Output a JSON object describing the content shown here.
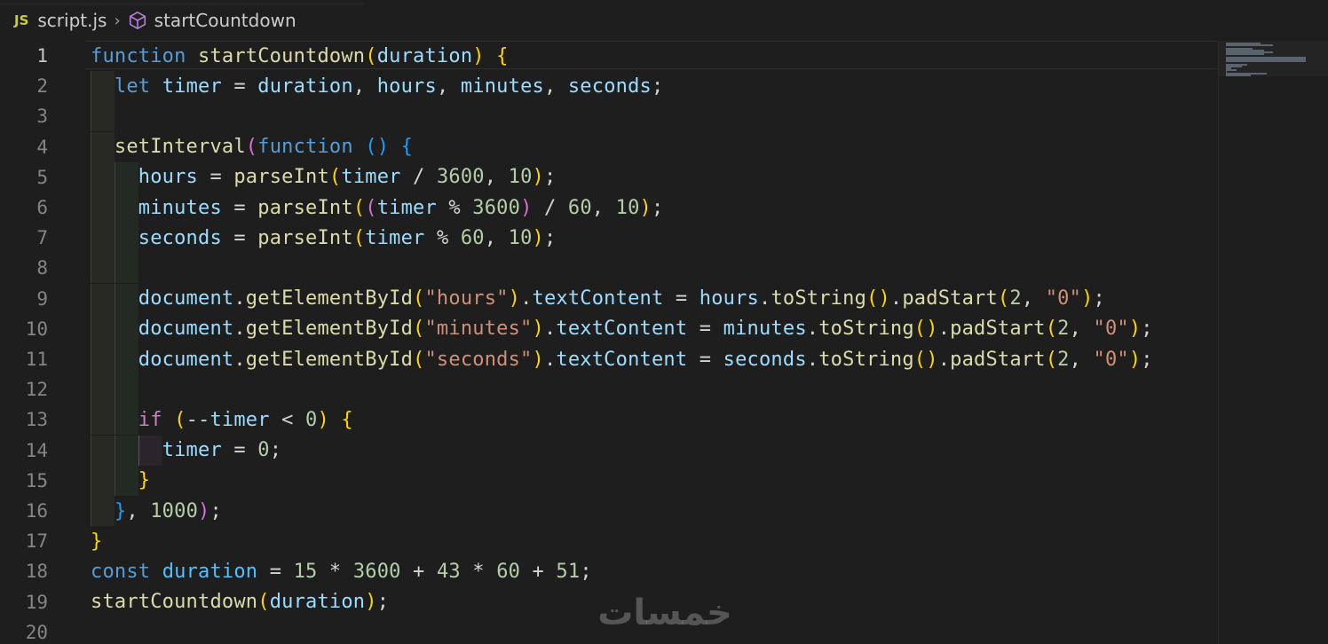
{
  "breadcrumb": {
    "file_icon": "JS",
    "file_name": "script.js",
    "separator": "›",
    "symbol_icon": "cube-icon",
    "symbol_name": "startCountdown"
  },
  "editor": {
    "active_line": 1,
    "line_numbers": [
      "1",
      "2",
      "3",
      "4",
      "5",
      "6",
      "7",
      "8",
      "9",
      "10",
      "11",
      "12",
      "13",
      "14",
      "15",
      "16",
      "17",
      "18",
      "19",
      "20"
    ],
    "lines": [
      [
        [
          "kw",
          "function"
        ],
        [
          "",
          " "
        ],
        [
          "fn",
          "startCountdown"
        ],
        [
          "b1",
          "("
        ],
        [
          "var",
          "duration"
        ],
        [
          "b1",
          ")"
        ],
        [
          "",
          " "
        ],
        [
          "b1",
          "{"
        ]
      ],
      [
        [
          "",
          "  "
        ],
        [
          "kw",
          "let"
        ],
        [
          "",
          " "
        ],
        [
          "var",
          "timer"
        ],
        [
          "",
          " = "
        ],
        [
          "var",
          "duration"
        ],
        [
          "",
          ", "
        ],
        [
          "var",
          "hours"
        ],
        [
          "",
          ", "
        ],
        [
          "var",
          "minutes"
        ],
        [
          "",
          ", "
        ],
        [
          "var",
          "seconds"
        ],
        [
          "",
          ";"
        ]
      ],
      [],
      [
        [
          "",
          "  "
        ],
        [
          "fn",
          "setInterval"
        ],
        [
          "b2",
          "("
        ],
        [
          "kw",
          "function"
        ],
        [
          "",
          " "
        ],
        [
          "b3",
          "()"
        ],
        [
          "",
          " "
        ],
        [
          "b3",
          "{"
        ]
      ],
      [
        [
          "",
          "    "
        ],
        [
          "var",
          "hours"
        ],
        [
          "",
          " = "
        ],
        [
          "fn",
          "parseInt"
        ],
        [
          "b1",
          "("
        ],
        [
          "var",
          "timer"
        ],
        [
          "",
          " / "
        ],
        [
          "num",
          "3600"
        ],
        [
          "",
          ", "
        ],
        [
          "num",
          "10"
        ],
        [
          "b1",
          ")"
        ],
        [
          "",
          ";"
        ]
      ],
      [
        [
          "",
          "    "
        ],
        [
          "var",
          "minutes"
        ],
        [
          "",
          " = "
        ],
        [
          "fn",
          "parseInt"
        ],
        [
          "b1",
          "("
        ],
        [
          "b2",
          "("
        ],
        [
          "var",
          "timer"
        ],
        [
          "",
          " % "
        ],
        [
          "num",
          "3600"
        ],
        [
          "b2",
          ")"
        ],
        [
          "",
          " / "
        ],
        [
          "num",
          "60"
        ],
        [
          "",
          ", "
        ],
        [
          "num",
          "10"
        ],
        [
          "b1",
          ")"
        ],
        [
          "",
          ";"
        ]
      ],
      [
        [
          "",
          "    "
        ],
        [
          "var",
          "seconds"
        ],
        [
          "",
          " = "
        ],
        [
          "fn",
          "parseInt"
        ],
        [
          "b1",
          "("
        ],
        [
          "var",
          "timer"
        ],
        [
          "",
          " % "
        ],
        [
          "num",
          "60"
        ],
        [
          "",
          ", "
        ],
        [
          "num",
          "10"
        ],
        [
          "b1",
          ")"
        ],
        [
          "",
          ";"
        ]
      ],
      [],
      [
        [
          "",
          "    "
        ],
        [
          "var",
          "document"
        ],
        [
          "",
          "."
        ],
        [
          "fn",
          "getElementById"
        ],
        [
          "b1",
          "("
        ],
        [
          "str",
          "\"hours\""
        ],
        [
          "b1",
          ")"
        ],
        [
          "",
          "."
        ],
        [
          "var",
          "textContent"
        ],
        [
          "",
          " = "
        ],
        [
          "var",
          "hours"
        ],
        [
          "",
          "."
        ],
        [
          "fn",
          "toString"
        ],
        [
          "b1",
          "()"
        ],
        [
          "",
          "."
        ],
        [
          "fn",
          "padStart"
        ],
        [
          "b1",
          "("
        ],
        [
          "num",
          "2"
        ],
        [
          "",
          ", "
        ],
        [
          "str",
          "\"0\""
        ],
        [
          "b1",
          ")"
        ],
        [
          "",
          ";"
        ]
      ],
      [
        [
          "",
          "    "
        ],
        [
          "var",
          "document"
        ],
        [
          "",
          "."
        ],
        [
          "fn",
          "getElementById"
        ],
        [
          "b1",
          "("
        ],
        [
          "str",
          "\"minutes\""
        ],
        [
          "b1",
          ")"
        ],
        [
          "",
          "."
        ],
        [
          "var",
          "textContent"
        ],
        [
          "",
          " = "
        ],
        [
          "var",
          "minutes"
        ],
        [
          "",
          "."
        ],
        [
          "fn",
          "toString"
        ],
        [
          "b1",
          "()"
        ],
        [
          "",
          "."
        ],
        [
          "fn",
          "padStart"
        ],
        [
          "b1",
          "("
        ],
        [
          "num",
          "2"
        ],
        [
          "",
          ", "
        ],
        [
          "str",
          "\"0\""
        ],
        [
          "b1",
          ")"
        ],
        [
          "",
          ";"
        ]
      ],
      [
        [
          "",
          "    "
        ],
        [
          "var",
          "document"
        ],
        [
          "",
          "."
        ],
        [
          "fn",
          "getElementById"
        ],
        [
          "b1",
          "("
        ],
        [
          "str",
          "\"seconds\""
        ],
        [
          "b1",
          ")"
        ],
        [
          "",
          "."
        ],
        [
          "var",
          "textContent"
        ],
        [
          "",
          " = "
        ],
        [
          "var",
          "seconds"
        ],
        [
          "",
          "."
        ],
        [
          "fn",
          "toString"
        ],
        [
          "b1",
          "()"
        ],
        [
          "",
          "."
        ],
        [
          "fn",
          "padStart"
        ],
        [
          "b1",
          "("
        ],
        [
          "num",
          "2"
        ],
        [
          "",
          ", "
        ],
        [
          "str",
          "\"0\""
        ],
        [
          "b1",
          ")"
        ],
        [
          "",
          ";"
        ]
      ],
      [],
      [
        [
          "",
          "    "
        ],
        [
          "ctrl",
          "if"
        ],
        [
          "",
          " "
        ],
        [
          "b1",
          "("
        ],
        [
          "",
          "--"
        ],
        [
          "var",
          "timer"
        ],
        [
          "",
          " < "
        ],
        [
          "num",
          "0"
        ],
        [
          "b1",
          ")"
        ],
        [
          "",
          " "
        ],
        [
          "b1",
          "{"
        ]
      ],
      [
        [
          "",
          "      "
        ],
        [
          "var",
          "timer"
        ],
        [
          "",
          " = "
        ],
        [
          "num",
          "0"
        ],
        [
          "",
          ";"
        ]
      ],
      [
        [
          "",
          "    "
        ],
        [
          "b1",
          "}"
        ]
      ],
      [
        [
          "",
          "  "
        ],
        [
          "b3",
          "}"
        ],
        [
          "",
          ", "
        ],
        [
          "num",
          "1000"
        ],
        [
          "b2",
          ")"
        ],
        [
          "",
          ";"
        ]
      ],
      [
        [
          "b1",
          "}"
        ]
      ],
      [
        [
          "kw",
          "const"
        ],
        [
          "",
          " "
        ],
        [
          "const",
          "duration"
        ],
        [
          "",
          " = "
        ],
        [
          "num",
          "15"
        ],
        [
          "",
          " * "
        ],
        [
          "num",
          "3600"
        ],
        [
          "",
          " + "
        ],
        [
          "num",
          "43"
        ],
        [
          "",
          " * "
        ],
        [
          "num",
          "60"
        ],
        [
          "",
          " + "
        ],
        [
          "num",
          "51"
        ],
        [
          "",
          ";"
        ]
      ],
      [
        [
          "fn",
          "startCountdown"
        ],
        [
          "b1",
          "("
        ],
        [
          "var",
          "duration"
        ],
        [
          "b1",
          ")"
        ],
        [
          "",
          ";"
        ]
      ],
      []
    ],
    "indent_depths": [
      0,
      1,
      1,
      1,
      2,
      2,
      2,
      2,
      2,
      2,
      2,
      2,
      2,
      3,
      2,
      1,
      0,
      0,
      0,
      0
    ]
  },
  "watermark": {
    "text": "خمسات"
  },
  "colors": {
    "background": "#1e1e1e",
    "keyword": "#569cd6",
    "control": "#c586c0",
    "function": "#dcdcaa",
    "variable": "#9cdcfe",
    "constant": "#4fc1ff",
    "number": "#b5cea8",
    "string": "#ce9178",
    "bracket_1": "#ffd700",
    "bracket_2": "#da70d6",
    "bracket_3": "#179fff"
  }
}
